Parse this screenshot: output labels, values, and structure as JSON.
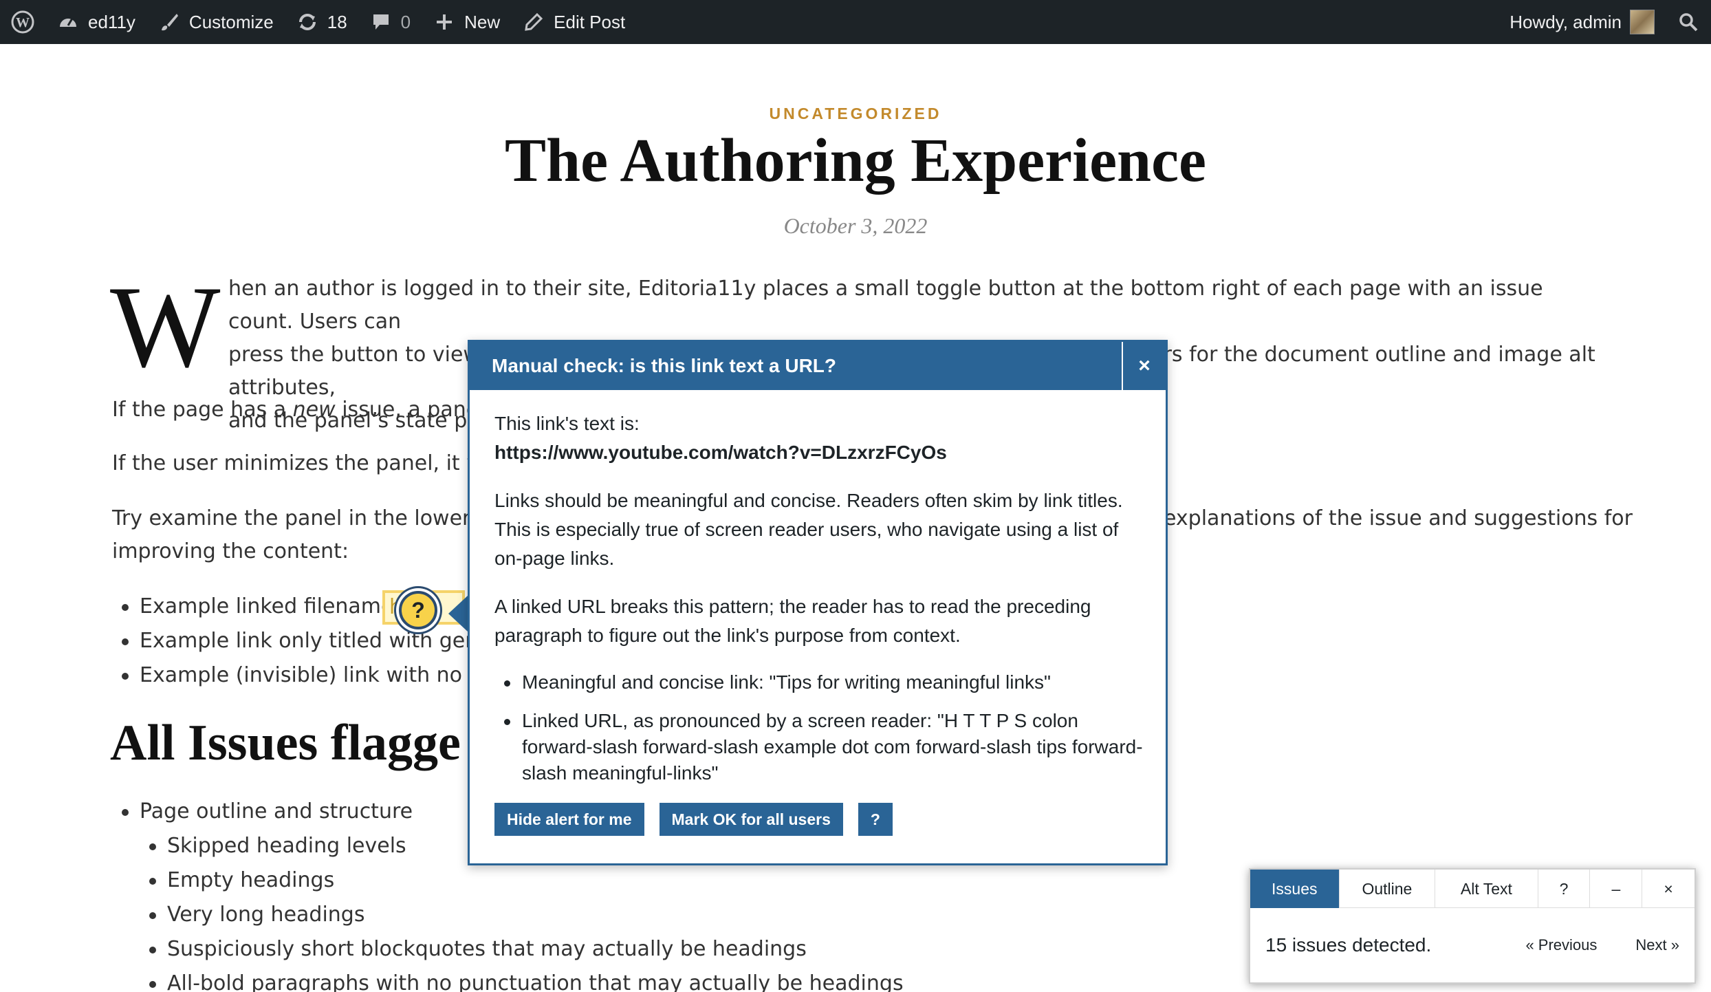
{
  "adminbar": {
    "site_name": "ed11y",
    "customize": "Customize",
    "updates": "18",
    "comments": "0",
    "new": "New",
    "edit": "Edit Post",
    "greeting": "Howdy, admin"
  },
  "article": {
    "category": "UNCATEGORIZED",
    "title": "The Authoring Experience",
    "date": "October 3, 2022",
    "dropcap": "W",
    "p1_line1": "hen an author is logged in to their site, Editoria11y places a small toggle button at the bottom right of each page with an issue count. Users can",
    "p1_line2": "press the button to view details of any alerts or access additional tools, including visualizers for the document outline and image alt attributes,",
    "p1_line3": "and the panel’s state pers",
    "p2_before": "If the page has a ",
    "p2_em": "new",
    "p2_after": " issue, a panel au",
    "p3": "If the user minimizes the panel, it will",
    "p4_left": "Try examine the panel in the lower ri",
    "p4_right": "explanations of the issue and suggestions for",
    "p4_line2": "improving the content:",
    "examples": [
      "Example linked filename:",
      "Example link only titled with gener",
      "Example (invisible) link with no acc"
    ],
    "link_fragment": "h",
    "h2": "All Issues flagge",
    "issues": [
      "Page outline and structure"
    ],
    "sub_issues": [
      "Skipped heading levels",
      "Empty headings",
      "Very long headings",
      "Suspiciously short blockquotes that may actually be headings",
      "All-bold paragraphs with no punctuation that may actually be headings"
    ]
  },
  "tooltip": {
    "title": "Manual check: is this link text a URL?",
    "close": "×",
    "intro": "This link's text is:",
    "url": "https://www.youtube.com/watch?v=DLzxrzFCyOs",
    "para1": "Links should be meaningful and concise. Readers often skim by link titles. This is especially true of screen reader users, who navigate using a list of on-page links.",
    "para2": "A linked URL breaks this pattern; the reader has to read the preceding paragraph to figure out the link's purpose from context.",
    "bullets": [
      "Meaningful and concise link: \"Tips for writing meaningful links\"",
      "Linked URL, as pronounced by a screen reader: \"H T T P S colon forward-slash forward-slash example dot com forward-slash tips forward-slash meaningful-links\""
    ],
    "hide_btn": "Hide alert for me",
    "ok_btn": "Mark OK for all users",
    "help_btn": "?"
  },
  "panel": {
    "tabs": [
      "Issues",
      "Outline",
      "Alt Text",
      "?",
      "–",
      "×"
    ],
    "count": "15 issues detected.",
    "prev": "« Previous",
    "next": "Next »"
  },
  "colors": {
    "adminbar": "#1d2327",
    "accent": "#2a6496",
    "category": "#c38a2c",
    "highlight": "#f8d24a"
  }
}
